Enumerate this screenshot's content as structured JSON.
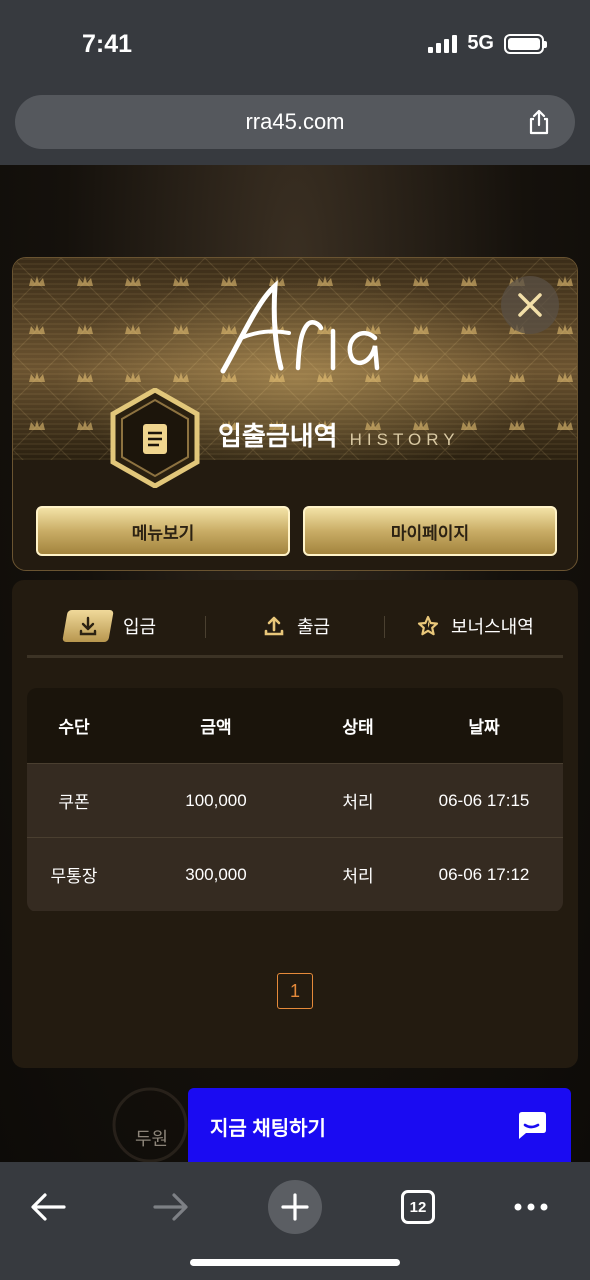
{
  "status_bar": {
    "time": "7:41",
    "network": "5G"
  },
  "browser": {
    "url": "rra45.com",
    "tab_count": "12"
  },
  "background": {
    "label": "두원"
  },
  "modal": {
    "logo_text": "Aria",
    "title_ko": "입출금내역",
    "title_en": "HISTORY",
    "buttons": {
      "menu": "메뉴보기",
      "mypage": "마이페이지"
    }
  },
  "history": {
    "tabs": [
      {
        "label": "입금",
        "icon": "download-icon",
        "active": true
      },
      {
        "label": "출금",
        "icon": "upload-icon",
        "active": false
      },
      {
        "label": "보너스내역",
        "icon": "star-icon",
        "active": false
      }
    ],
    "columns": [
      "수단",
      "금액",
      "상태",
      "날짜"
    ],
    "rows": [
      {
        "method": "쿠폰",
        "amount": "100,000",
        "status": "처리",
        "date": "06-06 17:15"
      },
      {
        "method": "무통장",
        "amount": "300,000",
        "status": "처리",
        "date": "06-06 17:12"
      }
    ],
    "pagination": {
      "current": "1"
    }
  },
  "chat": {
    "label": "지금 채팅하기"
  },
  "colors": {
    "accent_gold": "#c9ad66",
    "page_active": "#e58a3a",
    "chat_blue": "#1a0bf2"
  }
}
